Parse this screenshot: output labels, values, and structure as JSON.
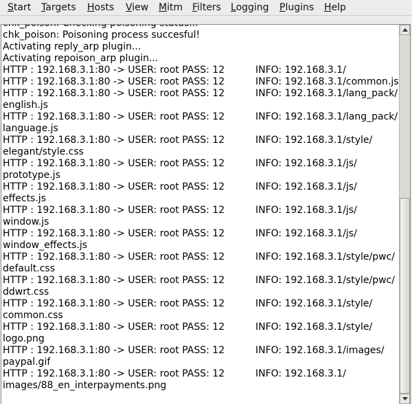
{
  "menubar": {
    "items": [
      {
        "mnemonic": "S",
        "rest": "tart"
      },
      {
        "mnemonic": "T",
        "rest": "argets"
      },
      {
        "mnemonic": "H",
        "rest": "osts"
      },
      {
        "mnemonic": "V",
        "rest": "iew"
      },
      {
        "mnemonic": "M",
        "rest": "itm"
      },
      {
        "mnemonic": "F",
        "rest": "ilters"
      },
      {
        "mnemonic": "L",
        "rest": "ogging"
      },
      {
        "mnemonic": "P",
        "rest": "lugins"
      },
      {
        "mnemonic": "H",
        "rest": "elp"
      }
    ]
  },
  "log": {
    "lines": [
      {
        "text": "chk_poison: Checking poisoning status..."
      },
      {
        "text": "chk_poison: Poisoning process succesful!"
      },
      {
        "text": "Activating reply_arp plugin..."
      },
      {
        "text": "Activating repoison_arp plugin..."
      },
      {
        "text": "HTTP : 192.168.3.1:80 -> USER: root  PASS: 12",
        "info": "INFO: 192.168.3.1/"
      },
      {
        "text": "HTTP : 192.168.3.1:80 -> USER: root  PASS: 12",
        "info": "INFO: 192.168.3.1/common.js"
      },
      {
        "text": "HTTP : 192.168.3.1:80 -> USER: root  PASS: 12",
        "info": "INFO: 192.168.3.1/lang_pack/"
      },
      {
        "text": "english.js"
      },
      {
        "text": "HTTP : 192.168.3.1:80 -> USER: root  PASS: 12",
        "info": "INFO: 192.168.3.1/lang_pack/"
      },
      {
        "text": "language.js"
      },
      {
        "text": "HTTP : 192.168.3.1:80 -> USER: root  PASS: 12",
        "info": "INFO: 192.168.3.1/style/"
      },
      {
        "text": "elegant/style.css"
      },
      {
        "text": "HTTP : 192.168.3.1:80 -> USER: root  PASS: 12",
        "info": "INFO: 192.168.3.1/js/"
      },
      {
        "text": "prototype.js"
      },
      {
        "text": "HTTP : 192.168.3.1:80 -> USER: root  PASS: 12",
        "info": "INFO: 192.168.3.1/js/"
      },
      {
        "text": "effects.js"
      },
      {
        "text": "HTTP : 192.168.3.1:80 -> USER: root  PASS: 12",
        "info": "INFO: 192.168.3.1/js/"
      },
      {
        "text": "window.js"
      },
      {
        "text": "HTTP : 192.168.3.1:80 -> USER: root  PASS: 12",
        "info": "INFO: 192.168.3.1/js/"
      },
      {
        "text": "window_effects.js"
      },
      {
        "text": "HTTP : 192.168.3.1:80 -> USER: root  PASS: 12",
        "info": "INFO: 192.168.3.1/style/pwc/"
      },
      {
        "text": "default.css"
      },
      {
        "text": "HTTP : 192.168.3.1:80 -> USER: root  PASS: 12",
        "info": "INFO: 192.168.3.1/style/pwc/"
      },
      {
        "text": "ddwrt.css"
      },
      {
        "text": "HTTP : 192.168.3.1:80 -> USER: root  PASS: 12",
        "info": "INFO: 192.168.3.1/style/"
      },
      {
        "text": "common.css"
      },
      {
        "text": "HTTP : 192.168.3.1:80 -> USER: root  PASS: 12",
        "info": "INFO: 192.168.3.1/style/"
      },
      {
        "text": "logo.png"
      },
      {
        "text": "HTTP : 192.168.3.1:80 -> USER: root  PASS: 12",
        "info": "INFO: 192.168.3.1/images/"
      },
      {
        "text": "paypal.gif"
      },
      {
        "text": "HTTP : 192.168.3.1:80 -> USER: root  PASS: 12",
        "info": "INFO: 192.168.3.1/"
      },
      {
        "text": "images/88_en_interpayments.png"
      }
    ]
  },
  "scrollbar": {
    "position_fraction": 1.0
  }
}
